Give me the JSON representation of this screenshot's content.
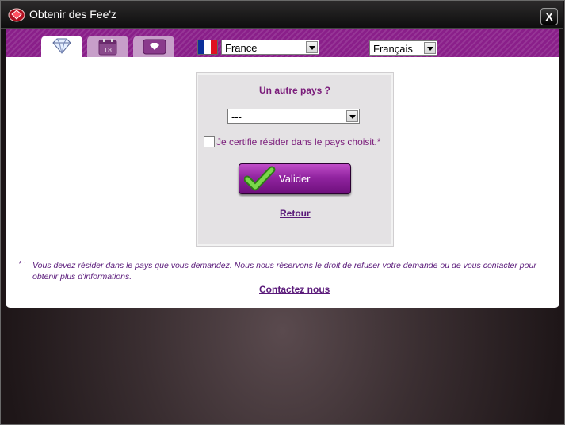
{
  "window": {
    "title": "Obtenir des Fee'z",
    "close_label": "X"
  },
  "tabs": [
    {
      "icon": "diamond-icon",
      "active": true
    },
    {
      "icon": "calendar-icon",
      "active": false,
      "day": "18"
    },
    {
      "icon": "gem-card-icon",
      "active": false
    }
  ],
  "country_select": {
    "value": "France",
    "flag": [
      "#0b2f9a",
      "#ffffff",
      "#e01020"
    ]
  },
  "language_select": {
    "value": "Français"
  },
  "card": {
    "title": "Un autre pays ?",
    "country_other_value": "---",
    "checkbox_label": "Je certifie résider dans le pays choisit.*",
    "validate_label": "Valider",
    "back_link": "Retour"
  },
  "footnote": {
    "marker": "* :",
    "line1": "Vous devez résider dans le pays que vous demandez. Nous nous réservons le droit de refuser votre demande ou de vous contacter pour",
    "line2": "obtenir plus d'informations."
  },
  "contact_link": "Contactez nous",
  "colors": {
    "accent": "#8a1f8a",
    "link": "#5a1a7a",
    "check": "#4cb82a"
  }
}
